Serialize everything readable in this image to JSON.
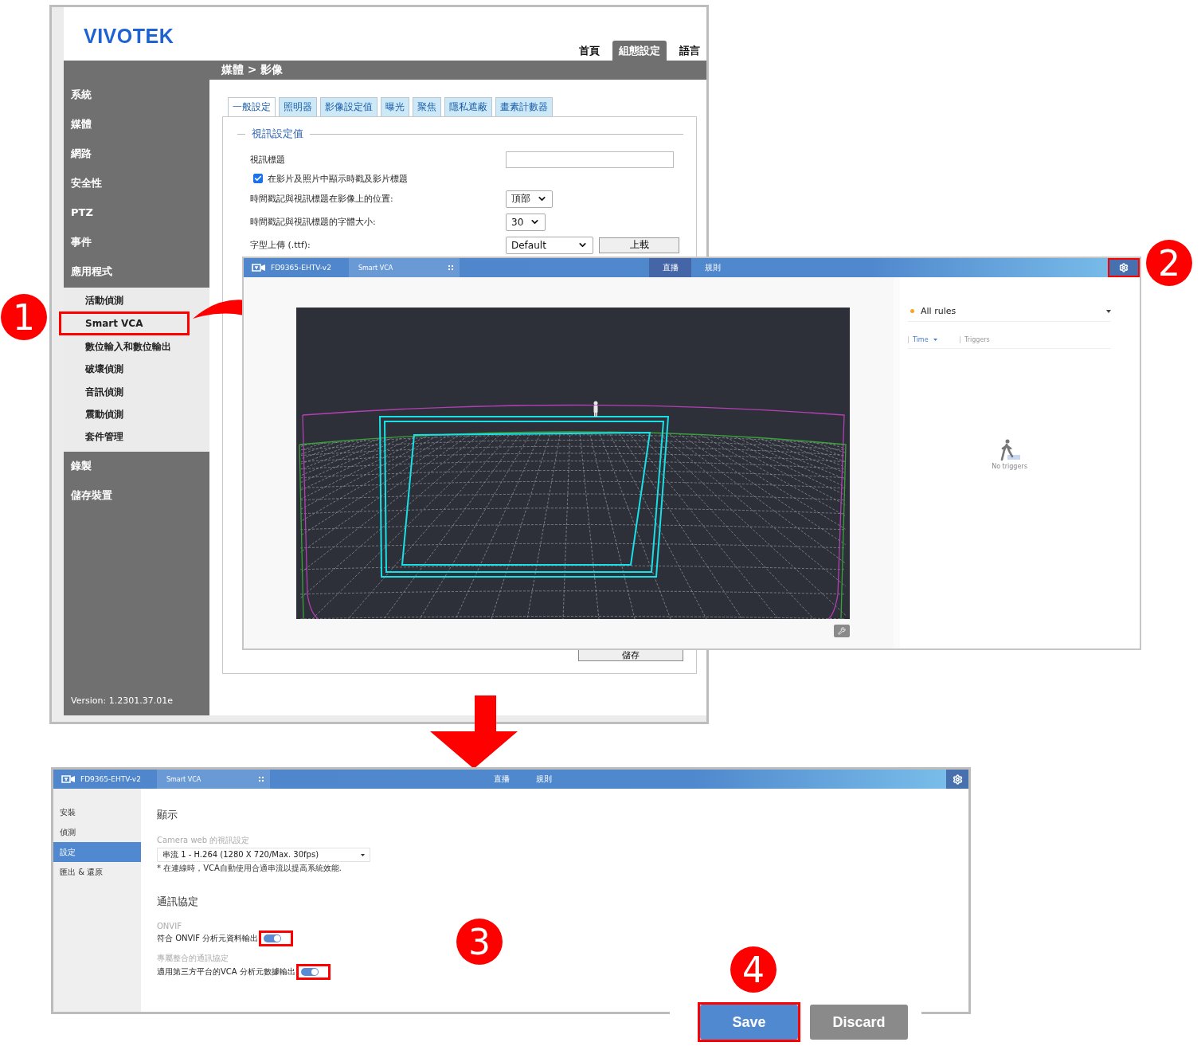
{
  "step_badges": [
    {
      "label": "1"
    },
    {
      "label": "2"
    },
    {
      "label": "3"
    },
    {
      "label": "4"
    }
  ],
  "camera_config": {
    "logo": "VIVOTEK",
    "top_tabs": [
      {
        "label": "首頁",
        "selected": false
      },
      {
        "label": "組態設定",
        "selected": true
      },
      {
        "label": "語言",
        "selected": false
      }
    ],
    "breadcrumb": "媒體 > 影像",
    "sidebar": [
      {
        "label": "系統"
      },
      {
        "label": "媒體"
      },
      {
        "label": "網路"
      },
      {
        "label": "安全性"
      },
      {
        "label": "PTZ"
      },
      {
        "label": "事件"
      },
      {
        "label": "應用程式",
        "children": [
          {
            "label": "活動偵測",
            "highlighted": false
          },
          {
            "label": "Smart VCA",
            "highlighted": true
          },
          {
            "label": "數位輸入和數位輸出",
            "highlighted": false
          },
          {
            "label": "破壞偵測",
            "highlighted": false
          },
          {
            "label": "音訊偵測",
            "highlighted": false
          },
          {
            "label": "震動偵測",
            "highlighted": false
          },
          {
            "label": "套件管理",
            "highlighted": false
          }
        ]
      },
      {
        "label": "錄製"
      },
      {
        "label": "儲存裝置"
      }
    ],
    "version": "Version: 1.2301.37.01e",
    "tabs": [
      {
        "label": "一般設定",
        "selected": true
      },
      {
        "label": "照明器",
        "selected": false
      },
      {
        "label": "影像設定值",
        "selected": false
      },
      {
        "label": "曝光",
        "selected": false
      },
      {
        "label": "聚焦",
        "selected": false
      },
      {
        "label": "隱私遮蔽",
        "selected": false
      },
      {
        "label": "畫素計數器",
        "selected": false
      }
    ],
    "section_title": "視訊設定值",
    "video_title": {
      "label": "視訊標題"
    },
    "show_timestamp": {
      "label": "在影片及照片中顯示時戳及影片標題",
      "checked": true
    },
    "position": {
      "label": "時間戳記與視訊標題在影像上的位置:",
      "value": "頂部"
    },
    "font_size": {
      "label": "時間戳記與視訊標題的字體大小:",
      "value": "30"
    },
    "font_upload": {
      "label": "字型上傳 (.ttf):",
      "value": "Default",
      "button": "上載"
    },
    "save_button": "儲存"
  },
  "vca_live": {
    "device": "FD9365-EHTV-v2",
    "app": "Smart VCA",
    "nav": [
      {
        "label": "直播",
        "selected": true
      },
      {
        "label": "規則",
        "selected": false
      }
    ],
    "rules_filter": "All rules",
    "columns": [
      "Time",
      "Triggers"
    ],
    "empty_text": "No triggers"
  },
  "vca_settings": {
    "device": "FD9365-EHTV-v2",
    "app": "Smart VCA",
    "nav": [
      {
        "label": "直播",
        "selected": false
      },
      {
        "label": "規則",
        "selected": false
      }
    ],
    "sidebar": [
      {
        "label": "安裝",
        "selected": false
      },
      {
        "label": "偵測",
        "selected": false
      },
      {
        "label": "設定",
        "selected": true
      },
      {
        "label": "匯出 & 還原",
        "selected": false
      }
    ],
    "display_title": "顯示",
    "stream_label": "Camera web 的視訊設定",
    "stream_value": "串流 1 - H.264 (1280 X 720/Max. 30fps)",
    "stream_note": "* 在連線時，VCA自動使用合適串流以提高系統效能.",
    "protocol_title": "通訊協定",
    "toggles": [
      {
        "group": "ONVIF",
        "label": "符合 ONVIF 分析元資料輸出",
        "on": true
      },
      {
        "group": "專屬整合的通訊協定",
        "label": "適用第三方平台的VCA 分析元數據輸出",
        "on": true
      }
    ]
  },
  "actions": [
    {
      "label": "Save",
      "kind": "primary"
    },
    {
      "label": "Discard",
      "kind": "secondary"
    }
  ]
}
